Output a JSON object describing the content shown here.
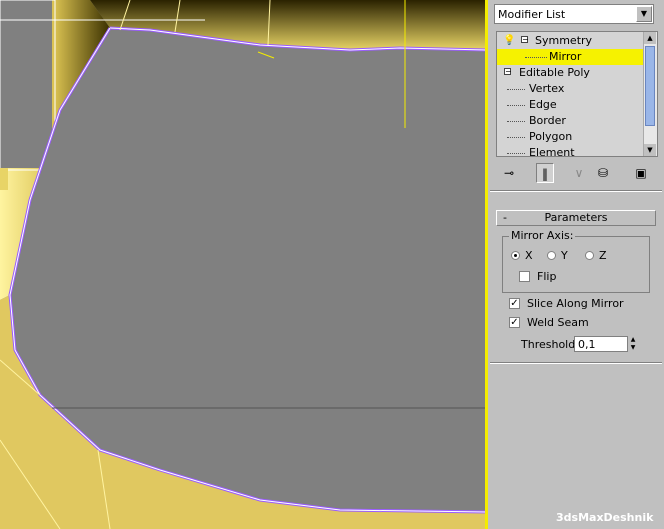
{
  "modifier_list": {
    "label": "Modifier List"
  },
  "stack": {
    "items": [
      {
        "label": "Symmetry",
        "type": "modifier"
      },
      {
        "label": "Mirror",
        "type": "sub",
        "selected": true
      },
      {
        "label": "Editable Poly",
        "type": "object"
      },
      {
        "label": "Vertex",
        "type": "sub"
      },
      {
        "label": "Edge",
        "type": "sub"
      },
      {
        "label": "Border",
        "type": "sub"
      },
      {
        "label": "Polygon",
        "type": "sub"
      },
      {
        "label": "Element",
        "type": "sub"
      }
    ]
  },
  "toolbar": {
    "icons": [
      "pin-stack-icon",
      "show-end-result-icon",
      "make-unique-icon",
      "remove-modifier-icon",
      "configure-modifier-sets-icon"
    ]
  },
  "parameters": {
    "rollout_collapse": "-",
    "title": "Parameters",
    "mirror_axis_label": "Mirror Axis:",
    "axis_x": "X",
    "axis_y": "Y",
    "axis_z": "Z",
    "selected_axis": "X",
    "flip_label": "Flip",
    "flip_checked": false,
    "slice_label": "Slice Along Mirror",
    "slice_checked": true,
    "weld_label": "Weld Seam",
    "weld_checked": true,
    "threshold_label": "Threshold:",
    "threshold_value": "0,1"
  },
  "watermark": "3dsMaxDeshnik",
  "colors": {
    "panel_bg": "#c0c0c0",
    "selection": "#f6f200",
    "viewport_border": "#f4ec00",
    "mesh_fill": "#808080",
    "mesh_yellow": "#e8d466"
  }
}
